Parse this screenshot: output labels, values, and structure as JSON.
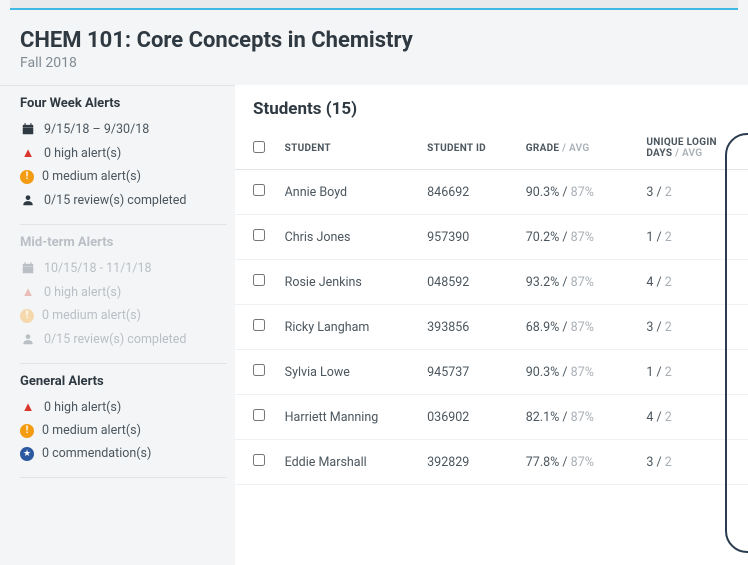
{
  "header": {
    "title": "CHEM 101: Core Concepts in Chemistry",
    "term": "Fall 2018"
  },
  "sidebar": {
    "groups": [
      {
        "title": "Four Week Alerts",
        "muted": false,
        "rows": [
          {
            "icon": "cal",
            "text": "9/15/18 – 9/30/18"
          },
          {
            "icon": "high",
            "text": "0 high alert(s)"
          },
          {
            "icon": "med",
            "text": "0 medium alert(s)"
          },
          {
            "icon": "rev",
            "text": "0/15 review(s) completed"
          }
        ]
      },
      {
        "title": "Mid-term Alerts",
        "muted": true,
        "rows": [
          {
            "icon": "cal",
            "text": "10/15/18 - 11/1/18"
          },
          {
            "icon": "high",
            "text": "0 high alert(s)"
          },
          {
            "icon": "med",
            "text": "0 medium alert(s)"
          },
          {
            "icon": "rev",
            "text": "0/15 review(s) completed"
          }
        ]
      },
      {
        "title": "General Alerts",
        "muted": false,
        "rows": [
          {
            "icon": "high",
            "text": "0 high alert(s)"
          },
          {
            "icon": "med",
            "text": "0 medium alert(s)"
          },
          {
            "icon": "star",
            "text": "0 commendation(s)"
          }
        ]
      }
    ]
  },
  "students": {
    "heading": "Students (15)",
    "columns": {
      "student": "STUDENT",
      "id": "STUDENT ID",
      "grade": "GRADE",
      "avg_label": " / AVG",
      "login": "UNIQUE LOGIN DAYS"
    },
    "rows": [
      {
        "name": "Annie Boyd",
        "id": "846692",
        "grade": "90.3%",
        "grade_avg": "87%",
        "login": "3",
        "login_avg": "2"
      },
      {
        "name": "Chris Jones",
        "id": "957390",
        "grade": "70.2%",
        "grade_avg": "87%",
        "login": "1",
        "login_avg": "2"
      },
      {
        "name": "Rosie Jenkins",
        "id": "048592",
        "grade": "93.2%",
        "grade_avg": "87%",
        "login": "4",
        "login_avg": "2"
      },
      {
        "name": "Ricky Langham",
        "id": "393856",
        "grade": "68.9%",
        "grade_avg": "87%",
        "login": "3",
        "login_avg": "2"
      },
      {
        "name": "Sylvia Lowe",
        "id": "945737",
        "grade": "90.3%",
        "grade_avg": "87%",
        "login": "1",
        "login_avg": "2"
      },
      {
        "name": "Harriett Manning",
        "id": "036902",
        "grade": "82.1%",
        "grade_avg": "87%",
        "login": "4",
        "login_avg": "2"
      },
      {
        "name": "Eddie Marshall",
        "id": "392829",
        "grade": "77.8%",
        "grade_avg": "87%",
        "login": "3",
        "login_avg": "2"
      }
    ]
  }
}
